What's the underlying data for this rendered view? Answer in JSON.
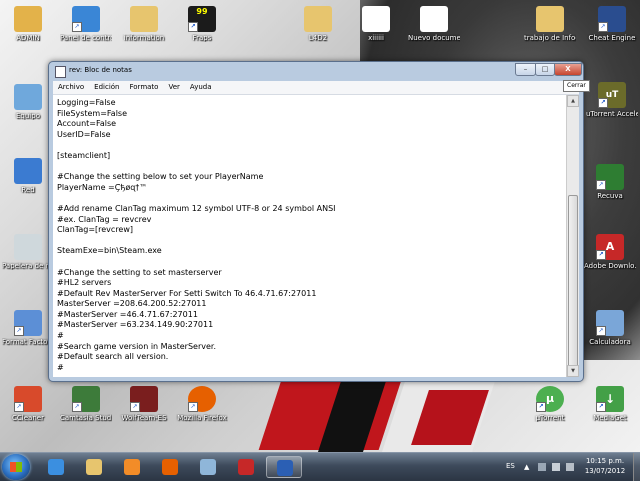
{
  "desktop": {
    "icons": [
      {
        "label": "ADMIN",
        "icon": "user-folder-icon",
        "color": "#e3b24a"
      },
      {
        "label": "Panel de control",
        "icon": "control-panel-icon",
        "color": "#3a86d6"
      },
      {
        "label": "information",
        "icon": "folder-icon",
        "color": "#e7c56e"
      },
      {
        "label": "Fraps",
        "icon": "fraps-icon",
        "color": "#1b1b1b"
      },
      {
        "label": "L4D2",
        "icon": "folder-icon",
        "color": "#e7c56e"
      },
      {
        "label": "xiiiiii",
        "icon": "text-file-icon",
        "color": "#ffffff"
      },
      {
        "label": "Nuevo documento ...",
        "icon": "text-file-icon",
        "color": "#ffffff"
      },
      {
        "label": "trabajo de Infografias",
        "icon": "folder-icon",
        "color": "#e7c56e"
      },
      {
        "label": "Cheat Engine",
        "icon": "cheat-engine-icon",
        "color": "#2a4d8f"
      },
      {
        "label": "Equipo",
        "icon": "computer-icon",
        "color": "#6fa8dc"
      },
      {
        "label": "uTorrent Accelerat...",
        "icon": "utorrent-accelerator-icon",
        "color": "#6b6b2a"
      },
      {
        "label": "Red",
        "icon": "network-icon",
        "color": "#3b7bd1"
      },
      {
        "label": "Recuva",
        "icon": "recuva-icon",
        "color": "#2e7d32"
      },
      {
        "label": "Papelera de reciclaje",
        "icon": "recycle-bin-icon",
        "color": "#cfd8dc"
      },
      {
        "label": "Adobe Downlo...",
        "icon": "adobe-icon",
        "color": "#c62828"
      },
      {
        "label": "Format Factory",
        "icon": "format-factory-icon",
        "color": "#5c8fd6"
      },
      {
        "label": "Calculadora",
        "icon": "calculator-icon",
        "color": "#7aa6d8"
      },
      {
        "label": "CCleaner",
        "icon": "ccleaner-icon",
        "color": "#d84a2b"
      },
      {
        "label": "Camtasia Studio 7",
        "icon": "camtasia-icon",
        "color": "#3d7b3a"
      },
      {
        "label": "WolfTeam-ES",
        "icon": "wolfteam-icon",
        "color": "#7a1e1e"
      },
      {
        "label": "Mozilla Firefox",
        "icon": "firefox-icon",
        "color": "#e66000"
      },
      {
        "label": "µTorrent",
        "icon": "utorrent-icon",
        "color": "#4caf50"
      },
      {
        "label": "MediaGet",
        "icon": "mediaget-icon",
        "color": "#43a047"
      }
    ]
  },
  "window": {
    "title": "rev: Bloc de notas",
    "close_tooltip": "Cerrar",
    "buttons": {
      "minimize": "–",
      "maximize": "□",
      "close": "X"
    },
    "menu": [
      "Archivo",
      "Edición",
      "Formato",
      "Ver",
      "Ayuda"
    ],
    "content": "Logging=False\nFileSystem=False\nAccount=False\nUserID=False\n\n[steamclient]\n\n#Change the setting below to set your PlayerName\nPlayerName =Ç̄ђøɋ†™\n\n#Add rename ClanTag maximum 12 symbol UTF-8 or 24 symbol ANSI\n#ex. ClanTag = revcrev\nClanTag=[revcrew]\n\nSteamExe=bin\\Steam.exe\n\n#Change the setting to set masterserver\n#HL2 servers\n#Default Rev MasterServer For Setti Switch To 46.4.71.67:27011\nMasterServer =208.64.200.52:27011\n#MasterServer =46.4.71.67:27011\n#MasterServer =63.234.149.90:27011\n#\n#Search game version in MasterServer.\n#Default search all version.\n#"
  },
  "taskbar": {
    "items": [
      {
        "icon": "internet-explorer-icon",
        "color": "#3b8fe0"
      },
      {
        "icon": "explorer-folder-icon",
        "color": "#e7c56e"
      },
      {
        "icon": "media-player-icon",
        "color": "#f28c28"
      },
      {
        "icon": "firefox-icon",
        "color": "#e66000"
      },
      {
        "icon": "window-app-icon",
        "color": "#8fb6d9"
      },
      {
        "icon": "garena-icon",
        "color": "#c62828"
      },
      {
        "icon": "word-icon",
        "color": "#2b5fb4"
      }
    ],
    "language": "ES",
    "time": "10:15 p.m.",
    "date": "13/07/2012"
  }
}
